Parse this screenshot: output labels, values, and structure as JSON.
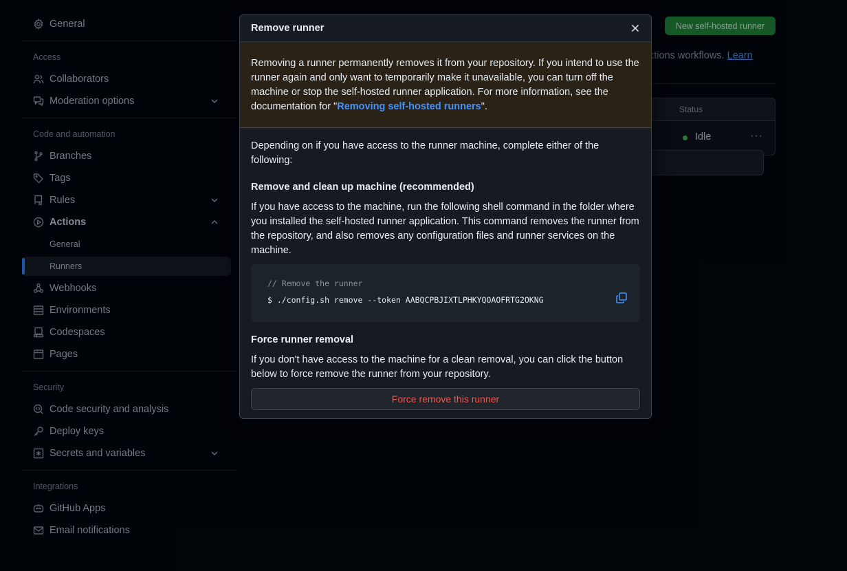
{
  "sidebar": {
    "general": "General",
    "sections": {
      "access": "Access",
      "code_automation": "Code and automation",
      "security": "Security",
      "integrations": "Integrations"
    },
    "items": {
      "collaborators": "Collaborators",
      "moderation": "Moderation options",
      "branches": "Branches",
      "tags": "Tags",
      "rules": "Rules",
      "actions": "Actions",
      "actions_general": "General",
      "actions_runners": "Runners",
      "webhooks": "Webhooks",
      "environments": "Environments",
      "codespaces": "Codespaces",
      "pages": "Pages",
      "code_security": "Code security and analysis",
      "deploy_keys": "Deploy keys",
      "secrets": "Secrets and variables",
      "github_apps": "GitHub Apps",
      "email_notifications": "Email notifications"
    },
    "accent_color": "#2f81f7"
  },
  "main": {
    "new_runner_label": "New self-hosted runner",
    "description_snippet": "ctions workflows.",
    "description_link": "Learn",
    "table": {
      "status_header": "Status",
      "status_value": "Idle",
      "row_menu": "···"
    }
  },
  "modal": {
    "title": "Remove runner",
    "warning_text": "Removing a runner permanently removes it from your repository. If you intend to use the runner again and only want to temporarily make it unavailable, you can turn off the machine or stop the self-hosted runner application. For more information, see the documentation for \"",
    "warning_link": "Removing self-hosted runners",
    "warning_suffix": "\".",
    "intro": "Depending on if you have access to the runner machine, complete either of the following:",
    "cleanup_heading": "Remove and clean up machine (recommended)",
    "cleanup_text": "If you have access to the machine, run the following shell command in the folder where you installed the self-hosted runner application. This command removes the runner from the repository, and also removes any configuration files and runner services on the machine.",
    "code_comment": "// Remove the runner",
    "code_command": "$ ./config.sh remove --token AABQCPBJIXTLPHKYQOAOFRTG2OKNG",
    "force_heading": "Force runner removal",
    "force_text": "If you don't have access to the machine for a clean removal, you can click the button below to force remove the runner from your repository.",
    "force_button": "Force remove this runner"
  }
}
